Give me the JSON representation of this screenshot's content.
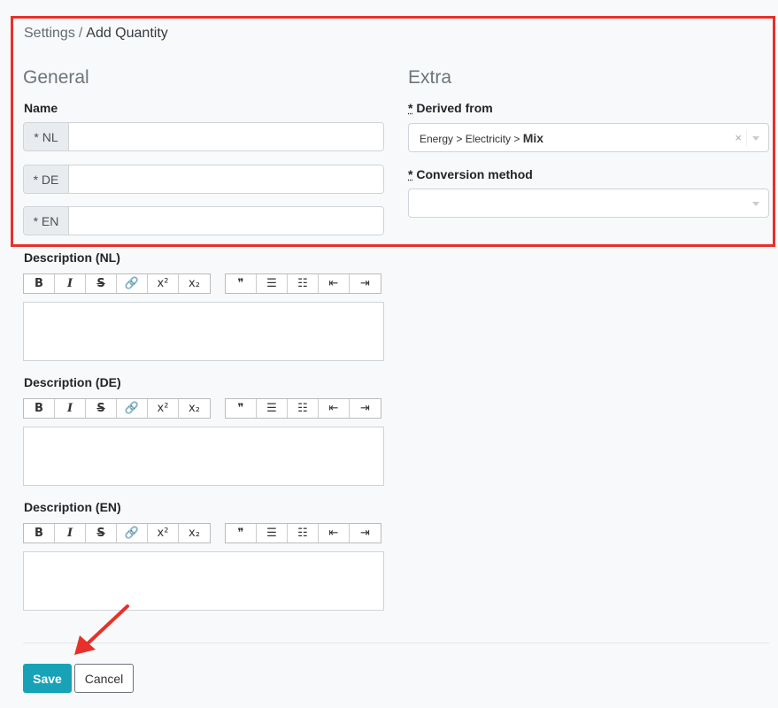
{
  "breadcrumb": {
    "parent": "Settings",
    "separator": "/",
    "current": "Add Quantity"
  },
  "general": {
    "title": "General",
    "name_label": "Name",
    "name_fields": [
      {
        "addon": "* NL",
        "value": ""
      },
      {
        "addon": "* DE",
        "value": ""
      },
      {
        "addon": "* EN",
        "value": ""
      }
    ]
  },
  "extra": {
    "title": "Extra",
    "derived_from": {
      "req": "*",
      "label": " Derived from",
      "value_path": "Energy > Electricity > ",
      "value_last": "Mix",
      "clear": "×"
    },
    "conversion_method": {
      "req": "*",
      "label": " Conversion method",
      "value": ""
    }
  },
  "descriptions": [
    {
      "label": "Description (NL)"
    },
    {
      "label": "Description (DE)"
    },
    {
      "label": "Description (EN)"
    }
  ],
  "toolbar": {
    "bold": "B",
    "italic": "I",
    "strike": "S",
    "link": "🔗",
    "superscript": "x²",
    "subscript": "x₂",
    "quote": "❞",
    "bullets": "☰",
    "numbers": "☷",
    "outdent": "⇤",
    "indent": "⇥"
  },
  "actions": {
    "save": "Save",
    "cancel": "Cancel"
  },
  "colors": {
    "highlight": "#e8302a",
    "primary": "#17a2b8",
    "arrow": "#e8302a"
  }
}
